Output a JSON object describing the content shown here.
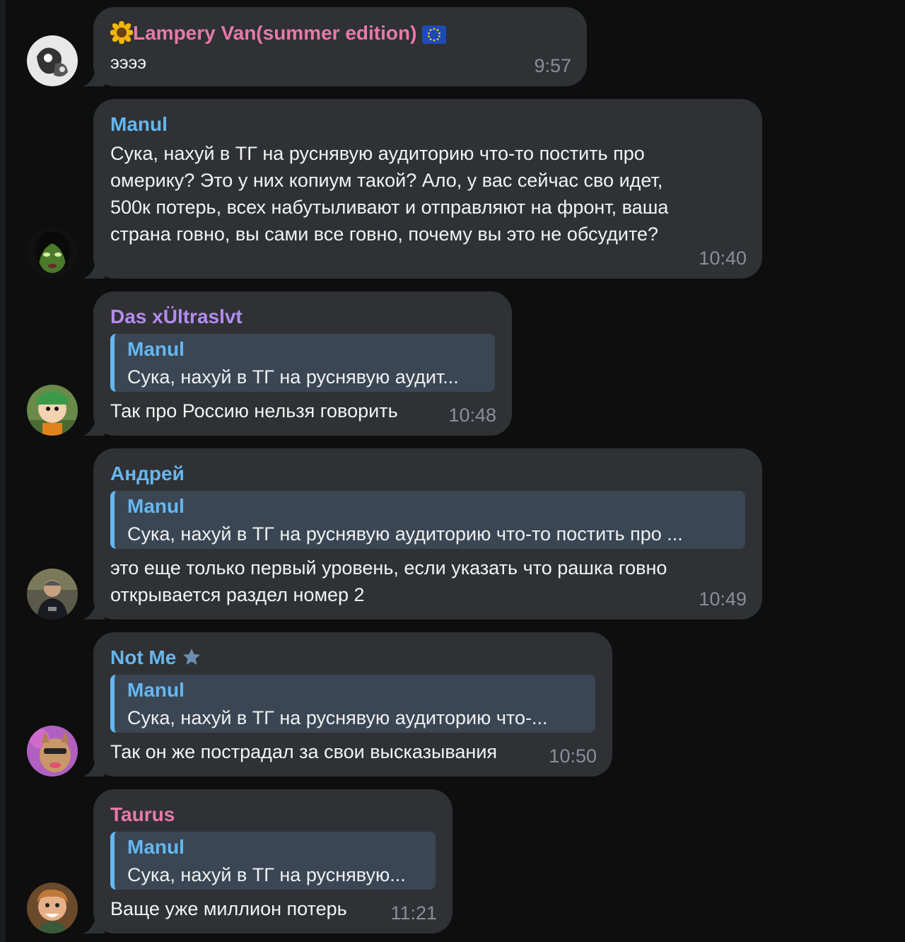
{
  "messages": [
    {
      "sender": "Lampery Van(summer edition)",
      "sender_prefix_icon": "sunflower-icon",
      "sender_suffix_icon": "eu-flag-icon",
      "sender_color": "#e87aa6",
      "text": "ээээ",
      "time": "9:57"
    },
    {
      "sender": "Manul",
      "sender_color": "#66b7ef",
      "lines": [
        "Сука, нахуй в ТГ на руснявую аудиторию что-то постить про",
        "омерику? Это у них копиум такой? Ало, у вас сейчас сво идет,",
        "500к потерь, всех набутыливают и отправляют на фронт, ваша",
        "страна говно, вы сами все говно, почему вы это не обсудите?"
      ],
      "time": "10:40"
    },
    {
      "sender": "Das xÜltraslvt",
      "sender_color": "#b38cf0",
      "reply": {
        "name": "Manul",
        "text": "Сука, нахуй в ТГ на руснявую аудит..."
      },
      "text": "Так про Россию нельзя говорить",
      "time": "10:48"
    },
    {
      "sender": "Андрей",
      "sender_color": "#66b7ef",
      "reply": {
        "name": "Manul",
        "text": "Сука, нахуй в ТГ на руснявую аудиторию что-то постить про ..."
      },
      "lines": [
        "это еще только первый уровень, если указать что рашка говно",
        "открывается раздел номер 2"
      ],
      "time": "10:49"
    },
    {
      "sender": "Not Me",
      "sender_suffix_icon": "star-icon",
      "sender_color": "#66b7ef",
      "reply": {
        "name": "Manul",
        "text": "Сука, нахуй в ТГ на руснявую аудиторию что-..."
      },
      "text": "Так он же пострадал за свои высказывания",
      "time": "10:50"
    },
    {
      "sender": "Taurus",
      "sender_color": "#e87aa6",
      "reply": {
        "name": "Manul",
        "text": "Сука, нахуй в ТГ на руснявую..."
      },
      "text": "Ваще уже миллион потерь",
      "time": "11:21"
    }
  ]
}
